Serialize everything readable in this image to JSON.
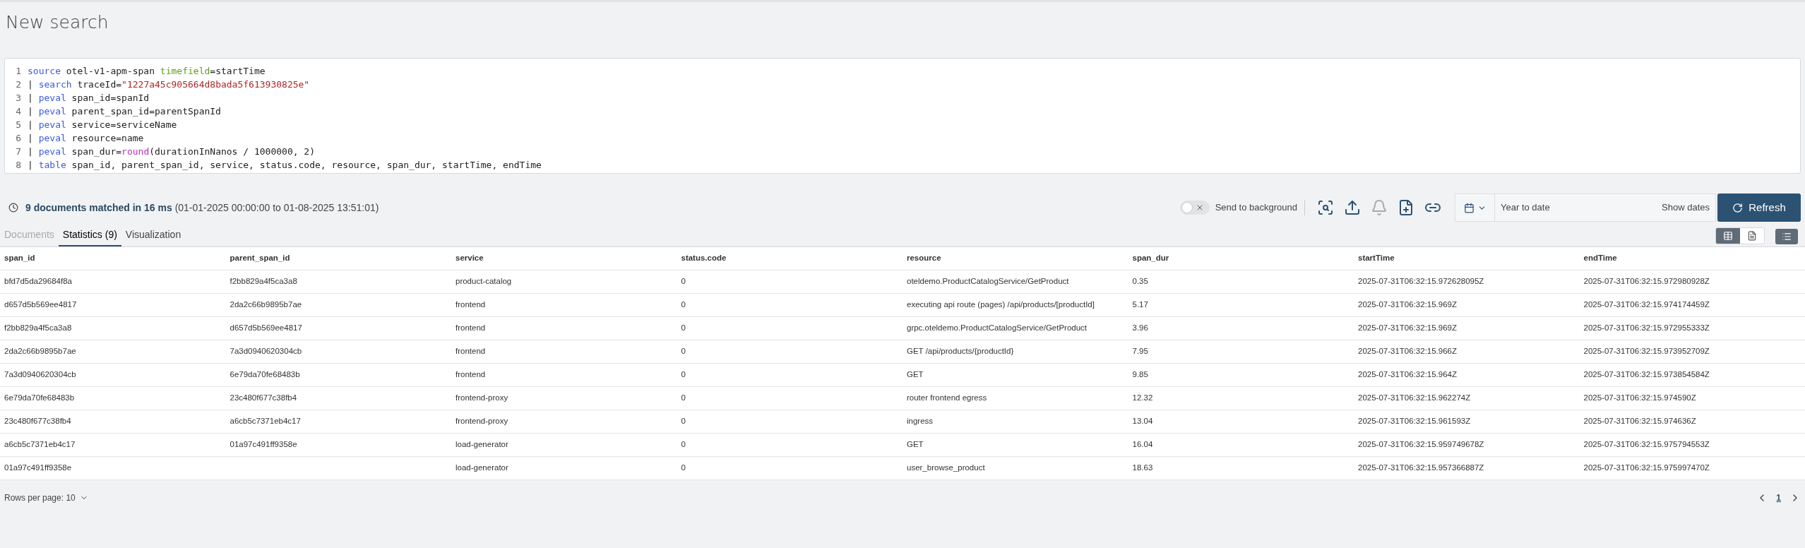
{
  "page_title": "New search",
  "query_lines": [
    {
      "number": "1",
      "tokens": [
        {
          "text": "source",
          "kind": "keyword"
        },
        {
          "text": " otel-v1-apm-span ",
          "kind": "plain"
        },
        {
          "text": "timefield",
          "kind": "option"
        },
        {
          "text": "=startTime",
          "kind": "plain"
        }
      ]
    },
    {
      "number": "2",
      "tokens": [
        {
          "text": "| ",
          "kind": "plain"
        },
        {
          "text": "search",
          "kind": "keyword"
        },
        {
          "text": " traceId=",
          "kind": "plain"
        },
        {
          "text": "\"1227a45c905664d8bada5f613930825e\"",
          "kind": "string"
        }
      ]
    },
    {
      "number": "3",
      "tokens": [
        {
          "text": "| ",
          "kind": "plain"
        },
        {
          "text": "peval",
          "kind": "keyword"
        },
        {
          "text": " span_id=spanId",
          "kind": "plain"
        }
      ]
    },
    {
      "number": "4",
      "tokens": [
        {
          "text": "| ",
          "kind": "plain"
        },
        {
          "text": "peval",
          "kind": "keyword"
        },
        {
          "text": " parent_span_id=parentSpanId",
          "kind": "plain"
        }
      ]
    },
    {
      "number": "5",
      "tokens": [
        {
          "text": "| ",
          "kind": "plain"
        },
        {
          "text": "peval",
          "kind": "keyword"
        },
        {
          "text": " service=serviceName",
          "kind": "plain"
        }
      ]
    },
    {
      "number": "6",
      "tokens": [
        {
          "text": "| ",
          "kind": "plain"
        },
        {
          "text": "peval",
          "kind": "keyword"
        },
        {
          "text": " resource=name",
          "kind": "plain"
        }
      ]
    },
    {
      "number": "7",
      "tokens": [
        {
          "text": "| ",
          "kind": "plain"
        },
        {
          "text": "peval",
          "kind": "keyword"
        },
        {
          "text": " span_dur=",
          "kind": "plain"
        },
        {
          "text": "round",
          "kind": "function"
        },
        {
          "text": "(durationInNanos / 1000000, 2)",
          "kind": "plain"
        }
      ]
    },
    {
      "number": "8",
      "tokens": [
        {
          "text": "| ",
          "kind": "plain"
        },
        {
          "text": "table",
          "kind": "keyword"
        },
        {
          "text": " span_id, parent_span_id, service, status.code, resource, span_dur, startTime, endTime",
          "kind": "plain"
        }
      ]
    }
  ],
  "result_summary": {
    "matched": "9 documents matched in 16 ms",
    "range": "(01-01-2025 00:00:00 to 01-08-2025 13:51:01)"
  },
  "send_to_background": {
    "label": "Send to background",
    "on": false
  },
  "date_picker": {
    "value": "Year to date",
    "show_dates": "Show dates"
  },
  "refresh_button": "Refresh",
  "tabs": [
    {
      "label": "Documents",
      "selected": false,
      "disabled": true
    },
    {
      "label": "Statistics (9)",
      "selected": true,
      "disabled": false
    },
    {
      "label": "Visualization",
      "selected": false,
      "disabled": false
    }
  ],
  "view_modes": [
    {
      "kind": "table",
      "selected": true
    },
    {
      "kind": "document",
      "selected": false
    }
  ],
  "table": {
    "columns": [
      "span_id",
      "parent_span_id",
      "service",
      "status.code",
      "resource",
      "span_dur",
      "startTime",
      "endTime"
    ],
    "rows": [
      [
        "bfd7d5da29684f8a",
        "f2bb829a4f5ca3a8",
        "product-catalog",
        "0",
        "oteldemo.ProductCatalogService/GetProduct",
        "0.35",
        "2025-07-31T06:32:15.972628095Z",
        "2025-07-31T06:32:15.972980928Z"
      ],
      [
        "d657d5b569ee4817",
        "2da2c66b9895b7ae",
        "frontend",
        "0",
        "executing api route (pages) /api/products/[productId]",
        "5.17",
        "2025-07-31T06:32:15.969Z",
        "2025-07-31T06:32:15.974174459Z"
      ],
      [
        "f2bb829a4f5ca3a8",
        "d657d5b569ee4817",
        "frontend",
        "0",
        "grpc.oteldemo.ProductCatalogService/GetProduct",
        "3.96",
        "2025-07-31T06:32:15.969Z",
        "2025-07-31T06:32:15.972955333Z"
      ],
      [
        "2da2c66b9895b7ae",
        "7a3d0940620304cb",
        "frontend",
        "0",
        "GET /api/products/{productId}",
        "7.95",
        "2025-07-31T06:32:15.966Z",
        "2025-07-31T06:32:15.973952709Z"
      ],
      [
        "7a3d0940620304cb",
        "6e79da70fe68483b",
        "frontend",
        "0",
        "GET",
        "9.85",
        "2025-07-31T06:32:15.964Z",
        "2025-07-31T06:32:15.973854584Z"
      ],
      [
        "6e79da70fe68483b",
        "23c480f677c38fb4",
        "frontend-proxy",
        "0",
        "router frontend egress",
        "12.32",
        "2025-07-31T06:32:15.962274Z",
        "2025-07-31T06:32:15.974590Z"
      ],
      [
        "23c480f677c38fb4",
        "a6cb5c7371eb4c17",
        "frontend-proxy",
        "0",
        "ingress",
        "13.04",
        "2025-07-31T06:32:15.961593Z",
        "2025-07-31T06:32:15.974636Z"
      ],
      [
        "a6cb5c7371eb4c17",
        "01a97c491ff9358e",
        "load-generator",
        "0",
        "GET",
        "16.04",
        "2025-07-31T06:32:15.959749678Z",
        "2025-07-31T06:32:15.975794553Z"
      ],
      [
        "01a97c491ff9358e",
        "",
        "load-generator",
        "0",
        "user_browse_product",
        "18.63",
        "2025-07-31T06:32:15.957366887Z",
        "2025-07-31T06:32:15.975997470Z"
      ]
    ]
  },
  "rows_per_page": "Rows per page: 10",
  "pages": [
    {
      "label": "1",
      "selected": true
    }
  ]
}
